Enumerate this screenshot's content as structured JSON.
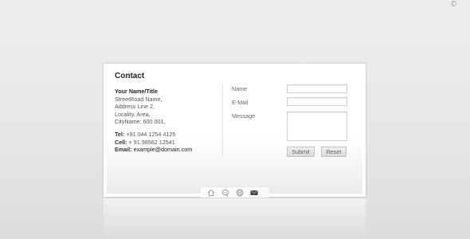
{
  "copyright_symbol": "©",
  "contact": {
    "title": "Contact",
    "name": "Your Name/Title",
    "address_lines": [
      "StreetRoad Name,",
      "Address Line 2,",
      "Locality, Area,",
      "CityName: 600 001,"
    ],
    "tel_label": "Tel:",
    "tel_value": "+91 044 1254 4125",
    "cell_label": "Cell:",
    "cell_value": "+ 91.98562 12541",
    "email_label": "Email:",
    "email_value": "example@domain.com"
  },
  "form": {
    "name_label": "Name",
    "email_label": "E-Mail",
    "message_label": "Message",
    "submit_label": "Submit",
    "reset_label": "Reset"
  },
  "icons": [
    "home-icon",
    "chat-icon",
    "globe-icon",
    "mail-icon"
  ]
}
